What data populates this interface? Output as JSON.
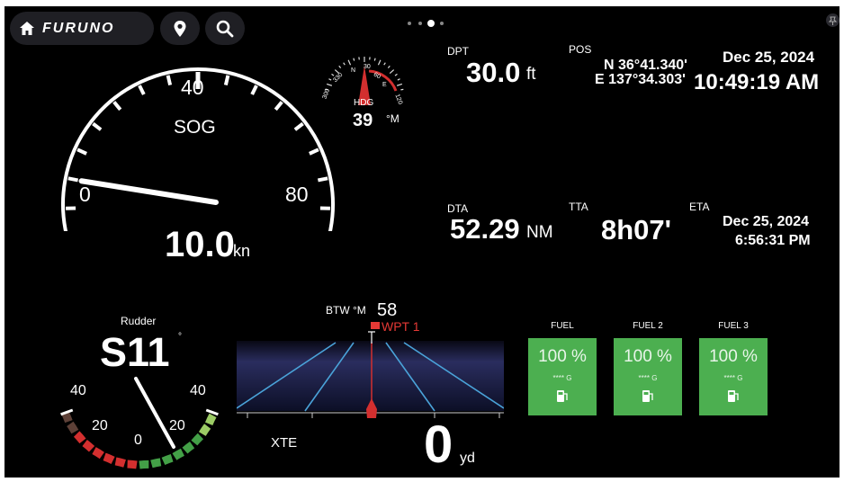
{
  "topbar": {
    "brand": "FURUNO",
    "home_icon": "home-icon",
    "location_icon": "location-pin-icon",
    "search_icon": "search-icon",
    "pin_icon": "pin-icon"
  },
  "page_dots": {
    "count": 4,
    "active": 3
  },
  "sog": {
    "label": "SOG",
    "min_label": "0",
    "mid_label": "40",
    "max_label": "80",
    "value": "10.0",
    "unit": "kn",
    "needle_value": 10
  },
  "heading": {
    "label": "HDG",
    "value": "39",
    "unit": "°M",
    "ticks": [
      "300",
      "330",
      "N",
      "30",
      "60",
      "E",
      "120"
    ]
  },
  "depth": {
    "label": "DPT",
    "value": "30.0",
    "unit": "ft"
  },
  "position": {
    "label": "POS",
    "lat": "N 36°41.340'",
    "lon": "E 137°34.303'"
  },
  "datetime": {
    "date": "Dec 25, 2024",
    "time": "10:49:19 AM"
  },
  "dta": {
    "label": "DTA",
    "value": "52.29",
    "unit": "NM"
  },
  "tta": {
    "label": "TTA",
    "value": "8h07'"
  },
  "eta": {
    "label": "ETA",
    "date": "Dec 25, 2024",
    "time": "6:56:31 PM"
  },
  "rudder": {
    "label": "Rudder",
    "value": "S11",
    "degree": "°",
    "labels": {
      "port_max": "40",
      "port_mid": "20",
      "center": "0",
      "stbd_mid": "20",
      "stbd_max": "40"
    },
    "angle": 11,
    "colors": {
      "port": "#d32f2f",
      "stbd": "#43a047"
    }
  },
  "highway": {
    "btw_label": "BTW °M",
    "btw_value": "58",
    "waypoint": "WPT 1",
    "xte_label": "XTE",
    "xte_value": "0",
    "xte_unit": "yd"
  },
  "fuel": [
    {
      "title": "FUEL",
      "value": "100 %",
      "gallons": "**** G"
    },
    {
      "title": "FUEL 2",
      "value": "100 %",
      "gallons": "**** G"
    },
    {
      "title": "FUEL 3",
      "value": "100 %",
      "gallons": "**** G"
    }
  ],
  "colors": {
    "fuel_card": "#4caf50",
    "waypoint": "#e53935",
    "heading_pointer": "#d32f2f"
  }
}
